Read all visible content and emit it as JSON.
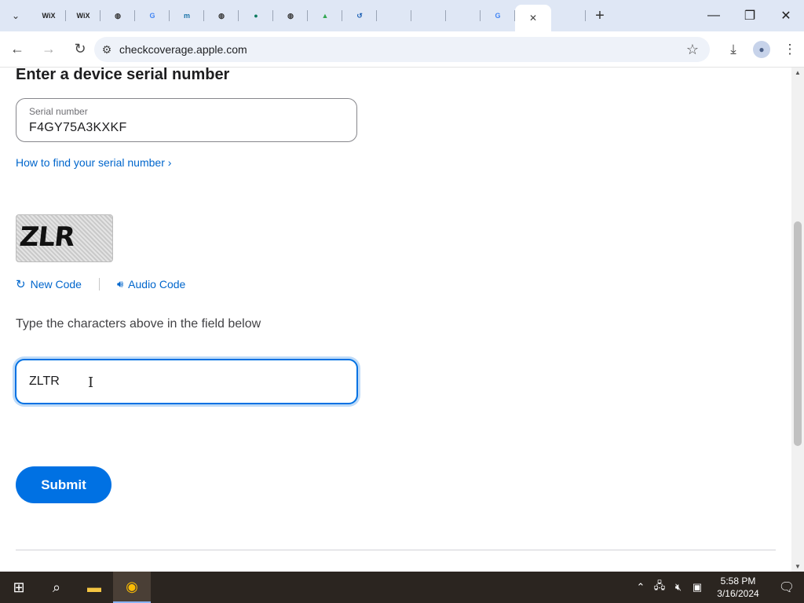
{
  "browser": {
    "tabs": [
      {
        "icon": "wix-icon",
        "glyph": "WiX",
        "color": "#222"
      },
      {
        "icon": "wix-icon",
        "glyph": "WiX",
        "color": "#222"
      },
      {
        "icon": "globe-icon",
        "glyph": "◍",
        "color": "#333"
      },
      {
        "icon": "google-icon",
        "glyph": "G",
        "color": "#4285f4"
      },
      {
        "icon": "m-icon",
        "glyph": "m",
        "color": "#1a73a8"
      },
      {
        "icon": "globe-icon",
        "glyph": "◍",
        "color": "#333"
      },
      {
        "icon": "green-circle-icon",
        "glyph": "●",
        "color": "#0d7a5f"
      },
      {
        "icon": "globe-icon",
        "glyph": "◍",
        "color": "#333"
      },
      {
        "icon": "drive-icon",
        "glyph": "▲",
        "color": "#34a853"
      },
      {
        "icon": "history-icon",
        "glyph": "↺",
        "color": "#1a5fb4"
      },
      {
        "icon": "apple-icon",
        "glyph": "",
        "color": "#222"
      },
      {
        "icon": "apple-icon",
        "glyph": "",
        "color": "#555"
      },
      {
        "icon": "apple-icon",
        "glyph": "",
        "color": "#222"
      },
      {
        "icon": "google-icon",
        "glyph": "G",
        "color": "#4285f4"
      }
    ],
    "active_tab_close": "✕",
    "after_active_tab": {
      "icon": "apple-icon",
      "glyph": "",
      "color": "#777"
    },
    "new_tab": "+",
    "url": "checkcoverage.apple.com"
  },
  "page": {
    "heading": "Enter a device serial number",
    "serial_label": "Serial number",
    "serial_value": "F4GY75A3KXKF",
    "find_link": "How to find your serial number ›",
    "captcha_text": "ZLR",
    "new_code": "New Code",
    "audio_code": "Audio Code",
    "instructions": "Type the characters above in the field below",
    "captcha_input_value": "ZLTR",
    "submit": "Submit"
  },
  "taskbar": {
    "time": "5:58 PM",
    "date": "3/16/2024"
  }
}
